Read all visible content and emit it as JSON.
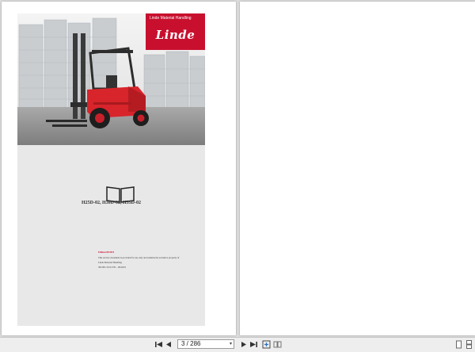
{
  "document": {
    "brand_label": "Linde Material Handling",
    "logo_text": "Linde",
    "model_title": "H25D-02, H30D-02, H35D-02",
    "edition_label": "Edition 09/2019",
    "note_lines": [
      "This service document is provided for use only and remains the exclusive property of",
      "Linde Material Handling",
      "393 801 50 01 EN – 09/2019"
    ]
  },
  "viewer": {
    "current_page": "3",
    "total_pages": "286",
    "page_display": "3 / 286"
  },
  "colors": {
    "brand_red": "#c8102e",
    "forklift_red": "#d8242b",
    "page_bg": "#ffffff",
    "viewer_bg": "#dcdcdc"
  },
  "icons": [
    "first-page-icon",
    "previous-page-icon",
    "next-page-icon",
    "last-page-icon",
    "fit-page-icon",
    "two-page-view-icon",
    "single-page-icon",
    "continuous-page-icon"
  ]
}
